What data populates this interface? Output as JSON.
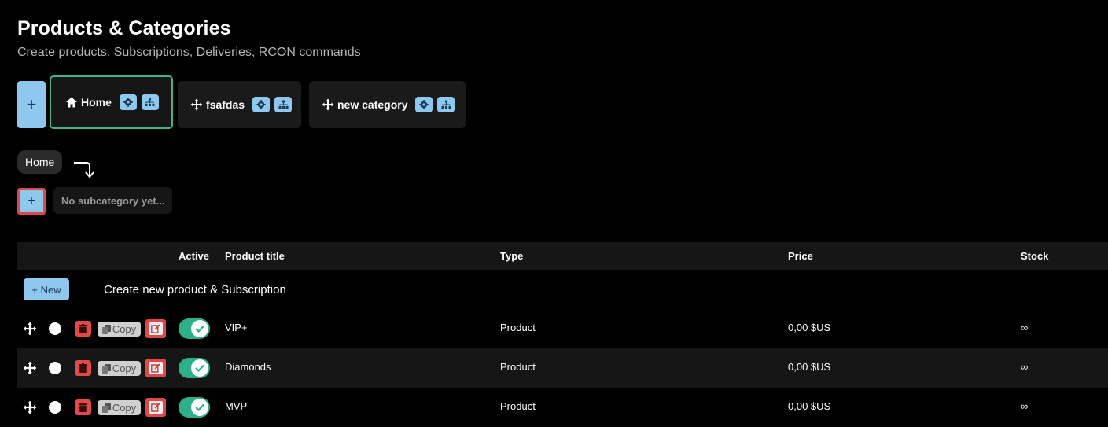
{
  "header": {
    "title": "Products & Categories",
    "subtitle": "Create products, Subscriptions, Deliveries, RCON commands"
  },
  "categories": [
    {
      "label": "Home",
      "icon": "home-icon",
      "active": true
    },
    {
      "label": "fsafdas",
      "icon": "move-icon",
      "active": false
    },
    {
      "label": "new category",
      "icon": "move-icon",
      "active": false
    }
  ],
  "add_category_symbol": "+",
  "breadcrumb": {
    "label": "Home"
  },
  "subcategory": {
    "add_symbol": "+",
    "empty_text": "No subcategory yet..."
  },
  "table": {
    "headers": {
      "active": "Active",
      "title": "Product title",
      "type": "Type",
      "price": "Price",
      "stock": "Stock"
    },
    "new_button": "+ New",
    "new_text": "Create new product & Subscription",
    "copy_label": "Copy",
    "rows": [
      {
        "title": "VIP+",
        "type": "Product",
        "price": "0,00 $US",
        "stock": "∞",
        "active": true
      },
      {
        "title": "Diamonds",
        "type": "Product",
        "price": "0,00 $US",
        "stock": "∞",
        "active": true
      },
      {
        "title": "MVP",
        "type": "Product",
        "price": "0,00 $US",
        "stock": "∞",
        "active": true
      }
    ]
  },
  "colors": {
    "accent_blue": "#8fc8ef",
    "accent_green": "#2db08a",
    "danger_red": "#e24a4a"
  }
}
